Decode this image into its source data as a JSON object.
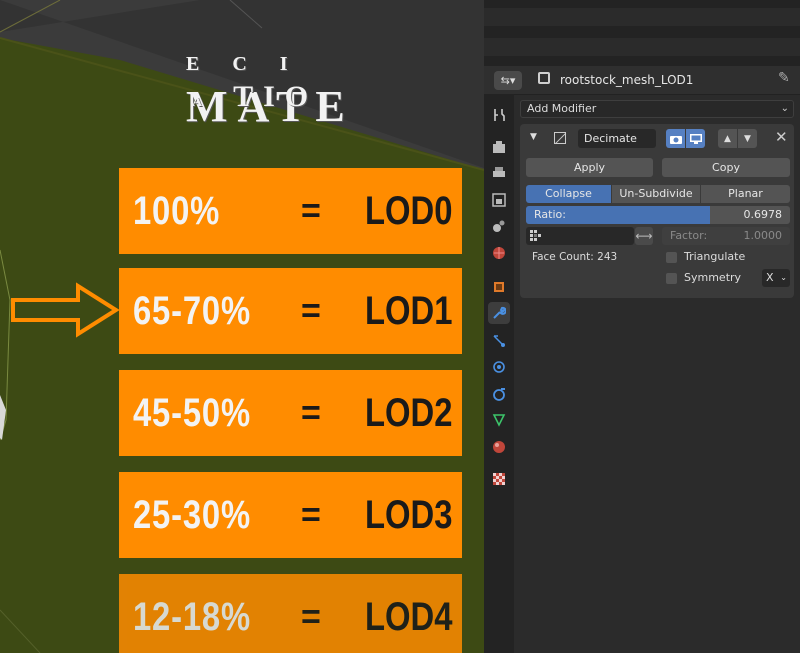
{
  "overlay": {
    "title_line1": {
      "small": "E C I",
      "large": "MATE"
    },
    "title_line2": {
      "small": "A",
      "large": "TIO"
    },
    "lod_rows": [
      {
        "percent": "100%",
        "equals": "=",
        "lod": "LOD0"
      },
      {
        "percent": "65-70%",
        "equals": "=",
        "lod": "LOD1"
      },
      {
        "percent": "45-50%",
        "equals": "=",
        "lod": "LOD2"
      },
      {
        "percent": "25-30%",
        "equals": "=",
        "lod": "LOD3"
      },
      {
        "percent": "12-18%",
        "equals": "=",
        "lod": "LOD4"
      }
    ],
    "highlight_row": 1,
    "colors": {
      "card": "#ff8c00",
      "arrow": "#ff8c00",
      "ground": "#3d4a14"
    }
  },
  "properties": {
    "header": {
      "editor_icon": "editor-type-icon",
      "object_name": "rootstock_mesh_LOD1",
      "pin_icon": "pin-icon"
    },
    "tabs": [
      {
        "icon": "tool-icon",
        "active": false
      },
      {
        "icon": "render-icon",
        "active": false
      },
      {
        "icon": "output-icon",
        "active": false
      },
      {
        "icon": "view-layer-icon",
        "active": false
      },
      {
        "icon": "scene-icon",
        "active": false
      },
      {
        "icon": "world-icon",
        "active": false
      },
      {
        "icon": "object-icon",
        "active": false
      },
      {
        "icon": "modifier-wrench-icon",
        "active": true
      },
      {
        "icon": "particles-icon",
        "active": false
      },
      {
        "icon": "physics-icon",
        "active": false
      },
      {
        "icon": "constraints-icon",
        "active": false
      },
      {
        "icon": "mesh-data-icon",
        "active": false
      },
      {
        "icon": "material-icon",
        "active": false
      },
      {
        "icon": "texture-icon",
        "active": false
      }
    ],
    "add_modifier_label": "Add Modifier",
    "modifier": {
      "name": "Decimate",
      "apply_label": "Apply",
      "copy_label": "Copy",
      "modes": [
        "Collapse",
        "Un-Subdivide",
        "Planar"
      ],
      "active_mode": "Collapse",
      "ratio_label": "Ratio:",
      "ratio_value": "0.6978",
      "ratio_fraction": 0.6978,
      "vertex_group": "",
      "factor_label": "Factor:",
      "factor_value": "1.0000",
      "face_count": "Face Count: 243",
      "triangulate_label": "Triangulate",
      "triangulate_checked": false,
      "symmetry_label": "Symmetry",
      "symmetry_checked": false,
      "symmetry_axis": "X"
    },
    "colors": {
      "accent": "#4772b3",
      "button": "#545454",
      "panel": "#3a3a3a"
    }
  }
}
